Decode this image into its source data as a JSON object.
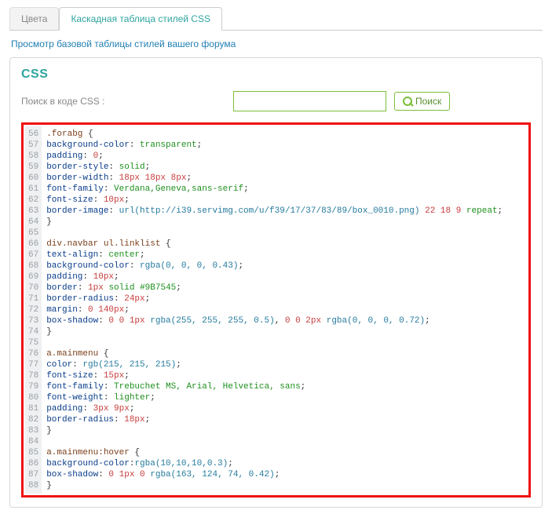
{
  "tabs": [
    {
      "label": "Цвета",
      "active": false
    },
    {
      "label": "Каскадная таблица стилей CSS",
      "active": true
    }
  ],
  "subtitle": "Просмотр базовой таблицы стилей вашего форума",
  "css_heading": "CSS",
  "search": {
    "label": "Поиск в коде CSS :",
    "value": "",
    "placeholder": "",
    "button_label": "Поиск"
  },
  "code_start_line": 56,
  "code_lines": [
    [
      [
        "sel",
        ".forabg"
      ],
      [
        "pl",
        " {"
      ]
    ],
    [
      [
        "pr",
        "background-color"
      ],
      [
        "pl",
        ": "
      ],
      [
        "kw",
        "transparent"
      ],
      [
        "pl",
        ";"
      ]
    ],
    [
      [
        "pr",
        "padding"
      ],
      [
        "pl",
        ": "
      ],
      [
        "vn",
        "0"
      ],
      [
        "pl",
        ";"
      ]
    ],
    [
      [
        "pr",
        "border-style"
      ],
      [
        "pl",
        ": "
      ],
      [
        "kw",
        "solid"
      ],
      [
        "pl",
        ";"
      ]
    ],
    [
      [
        "pr",
        "border-width"
      ],
      [
        "pl",
        ": "
      ],
      [
        "vn",
        "18px 18px 8px"
      ],
      [
        "pl",
        ";"
      ]
    ],
    [
      [
        "pr",
        "font-family"
      ],
      [
        "pl",
        ": "
      ],
      [
        "vs",
        "Verdana,Geneva,sans-serif"
      ],
      [
        "pl",
        ";"
      ]
    ],
    [
      [
        "pr",
        "font-size"
      ],
      [
        "pl",
        ": "
      ],
      [
        "vn",
        "10px"
      ],
      [
        "pl",
        ";"
      ]
    ],
    [
      [
        "pr",
        "border-image"
      ],
      [
        "pl",
        ": "
      ],
      [
        "fn",
        "url(http://i39.servimg.com/u/f39/17/37/83/89/box_0010.png)"
      ],
      [
        "pl",
        " "
      ],
      [
        "vn",
        "22 18 9"
      ],
      [
        "pl",
        " "
      ],
      [
        "kw",
        "repeat"
      ],
      [
        "pl",
        ";"
      ]
    ],
    [
      [
        "pl",
        "}"
      ]
    ],
    [
      [
        "pl",
        ""
      ]
    ],
    [
      [
        "sel",
        "div.navbar ul.linklist"
      ],
      [
        "pl",
        " {"
      ]
    ],
    [
      [
        "pr",
        "text-align"
      ],
      [
        "pl",
        ": "
      ],
      [
        "kw",
        "center"
      ],
      [
        "pl",
        ";"
      ]
    ],
    [
      [
        "pr",
        "background-color"
      ],
      [
        "pl",
        ": "
      ],
      [
        "fn",
        "rgba(0, 0, 0, 0.43)"
      ],
      [
        "pl",
        ";"
      ]
    ],
    [
      [
        "pr",
        "padding"
      ],
      [
        "pl",
        ": "
      ],
      [
        "vn",
        "10px"
      ],
      [
        "pl",
        ";"
      ]
    ],
    [
      [
        "pr",
        "border"
      ],
      [
        "pl",
        ": "
      ],
      [
        "vn",
        "1px"
      ],
      [
        "pl",
        " "
      ],
      [
        "kw",
        "solid"
      ],
      [
        "pl",
        " "
      ],
      [
        "vs",
        "#9B7545"
      ],
      [
        "pl",
        ";"
      ]
    ],
    [
      [
        "pr",
        "border-radius"
      ],
      [
        "pl",
        ": "
      ],
      [
        "vn",
        "24px"
      ],
      [
        "pl",
        ";"
      ]
    ],
    [
      [
        "pr",
        "margin"
      ],
      [
        "pl",
        ": "
      ],
      [
        "vn",
        "0 140px"
      ],
      [
        "pl",
        ";"
      ]
    ],
    [
      [
        "pr",
        "box-shadow"
      ],
      [
        "pl",
        ": "
      ],
      [
        "vn",
        "0 0 1px"
      ],
      [
        "pl",
        " "
      ],
      [
        "fn",
        "rgba(255, 255, 255, 0.5)"
      ],
      [
        "pl",
        ", "
      ],
      [
        "vn",
        "0 0 2px"
      ],
      [
        "pl",
        " "
      ],
      [
        "fn",
        "rgba(0, 0, 0, 0.72)"
      ],
      [
        "pl",
        ";"
      ]
    ],
    [
      [
        "pl",
        "}"
      ]
    ],
    [
      [
        "pl",
        ""
      ]
    ],
    [
      [
        "sel",
        "a.mainmenu"
      ],
      [
        "pl",
        " {"
      ]
    ],
    [
      [
        "pr",
        "color"
      ],
      [
        "pl",
        ": "
      ],
      [
        "fn",
        "rgb(215, 215, 215)"
      ],
      [
        "pl",
        ";"
      ]
    ],
    [
      [
        "pr",
        "font-size"
      ],
      [
        "pl",
        ": "
      ],
      [
        "vn",
        "15px"
      ],
      [
        "pl",
        ";"
      ]
    ],
    [
      [
        "pr",
        "font-family"
      ],
      [
        "pl",
        ": "
      ],
      [
        "vs",
        "Trebuchet MS, Arial, Helvetica, sans"
      ],
      [
        "pl",
        ";"
      ]
    ],
    [
      [
        "pr",
        "font-weight"
      ],
      [
        "pl",
        ": "
      ],
      [
        "kw",
        "lighter"
      ],
      [
        "pl",
        ";"
      ]
    ],
    [
      [
        "pr",
        "padding"
      ],
      [
        "pl",
        ": "
      ],
      [
        "vn",
        "3px 9px"
      ],
      [
        "pl",
        ";"
      ]
    ],
    [
      [
        "pr",
        "border-radius"
      ],
      [
        "pl",
        ": "
      ],
      [
        "vn",
        "18px"
      ],
      [
        "pl",
        ";"
      ]
    ],
    [
      [
        "pl",
        "}"
      ]
    ],
    [
      [
        "pl",
        ""
      ]
    ],
    [
      [
        "sel",
        "a.mainmenu:hover"
      ],
      [
        "pl",
        " {"
      ]
    ],
    [
      [
        "pr",
        "background-color"
      ],
      [
        "pl",
        ":"
      ],
      [
        "fn",
        "rgba(10,10,10,0.3)"
      ],
      [
        "pl",
        ";"
      ]
    ],
    [
      [
        "pr",
        "box-shadow"
      ],
      [
        "pl",
        ": "
      ],
      [
        "vn",
        "0 1px 0"
      ],
      [
        "pl",
        " "
      ],
      [
        "fn",
        "rgba(163, 124, 74, 0.42)"
      ],
      [
        "pl",
        ";"
      ]
    ],
    [
      [
        "pl",
        "}"
      ]
    ]
  ]
}
